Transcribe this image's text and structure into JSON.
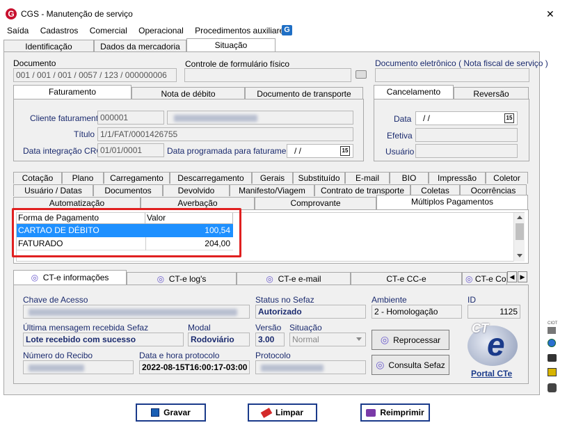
{
  "window": {
    "title": "CGS - Manutenção de serviço",
    "close": "✕"
  },
  "menu": [
    "Saída",
    "Cadastros",
    "Comercial",
    "Operacional",
    "Procedimentos auxiliares"
  ],
  "main_tabs": [
    "Identificação",
    "Dados da mercadoria",
    "Situação"
  ],
  "documento": {
    "label": "Documento",
    "value": "001 / 001 / 001 / 0057 / 123 / 000000006"
  },
  "controle": {
    "label": "Controle de formulário físico",
    "value": ""
  },
  "doc_eletronico": {
    "label": "Documento eletrônico ( Nota fiscal de serviço )",
    "value": ""
  },
  "fat_tabs": [
    "Faturamento",
    "Nota de débito",
    "Documento de transporte"
  ],
  "cancel_tabs": [
    "Cancelamento",
    "Reversão"
  ],
  "faturamento": {
    "cliente_label": "Cliente faturamento",
    "cliente_code": "000001",
    "titulo_label": "Título",
    "titulo_value": "1/1/FAT/0001426755",
    "data_crc_label": "Data integração CRC",
    "data_crc_value": "01/01/0001",
    "data_prog_label": "Data programada para faturamento",
    "data_prog_value": "/ /"
  },
  "cancelamento": {
    "data_label": "Data",
    "data_value": "/ /",
    "efetiva_label": "Efetiva",
    "usuario_label": "Usuário"
  },
  "calendar_glyph": "15",
  "tabs_row1": [
    "Cotação",
    "Plano",
    "Carregamento",
    "Descarregamento",
    "Gerais",
    "Substituído",
    "E-mail",
    "BIO",
    "Impressão",
    "Coletor"
  ],
  "tabs_row2": [
    "Usuário / Datas",
    "Documentos",
    "Devolvido",
    "Manifesto/Viagem",
    "Contrato de transporte",
    "Coletas",
    "Ocorrências"
  ],
  "tabs_row3": [
    "Automatização",
    "Averbação",
    "Comprovante",
    "Múltiplos Pagamentos"
  ],
  "pagamentos": {
    "headers": [
      "Forma de Pagamento",
      "Valor"
    ],
    "rows": [
      {
        "forma": "CARTAO DE DÉBITO",
        "valor": "100,54"
      },
      {
        "forma": "FATURADO",
        "valor": "204,00"
      }
    ]
  },
  "cte_tabs": [
    "CT-e informações",
    "CT-e log's",
    "CT-e e-mail",
    "CT-e CC-e",
    "CT-e Co"
  ],
  "cte": {
    "chave_label": "Chave de Acesso",
    "status_label": "Status no Sefaz",
    "status_value": "Autorizado",
    "ambiente_label": "Ambiente",
    "ambiente_value": "2 - Homologação",
    "id_label": "ID",
    "id_value": "1125",
    "ultima_label": "Última mensagem recebida Sefaz",
    "ultima_value": "Lote recebido com sucesso",
    "modal_label": "Modal",
    "modal_value": "Rodoviário",
    "versao_label": "Versão",
    "versao_value": "3.00",
    "situacao_label": "Situação",
    "situacao_value": "Normal",
    "recibo_label": "Número do Recibo",
    "data_prot_label": "Data e hora protocolo",
    "data_prot_value": "2022-08-15T16:00:17-03:00",
    "protocolo_label": "Protocolo",
    "reprocessar": "Reprocessar",
    "consulta": "Consulta Sefaz",
    "logo_text": "CT",
    "logo_e": "e",
    "portal": "Portal CTe"
  },
  "side_label": "CIOT",
  "buttons": {
    "gravar": "Gravar",
    "limpar": "Limpar",
    "reimprimir": "Reimprimir"
  }
}
